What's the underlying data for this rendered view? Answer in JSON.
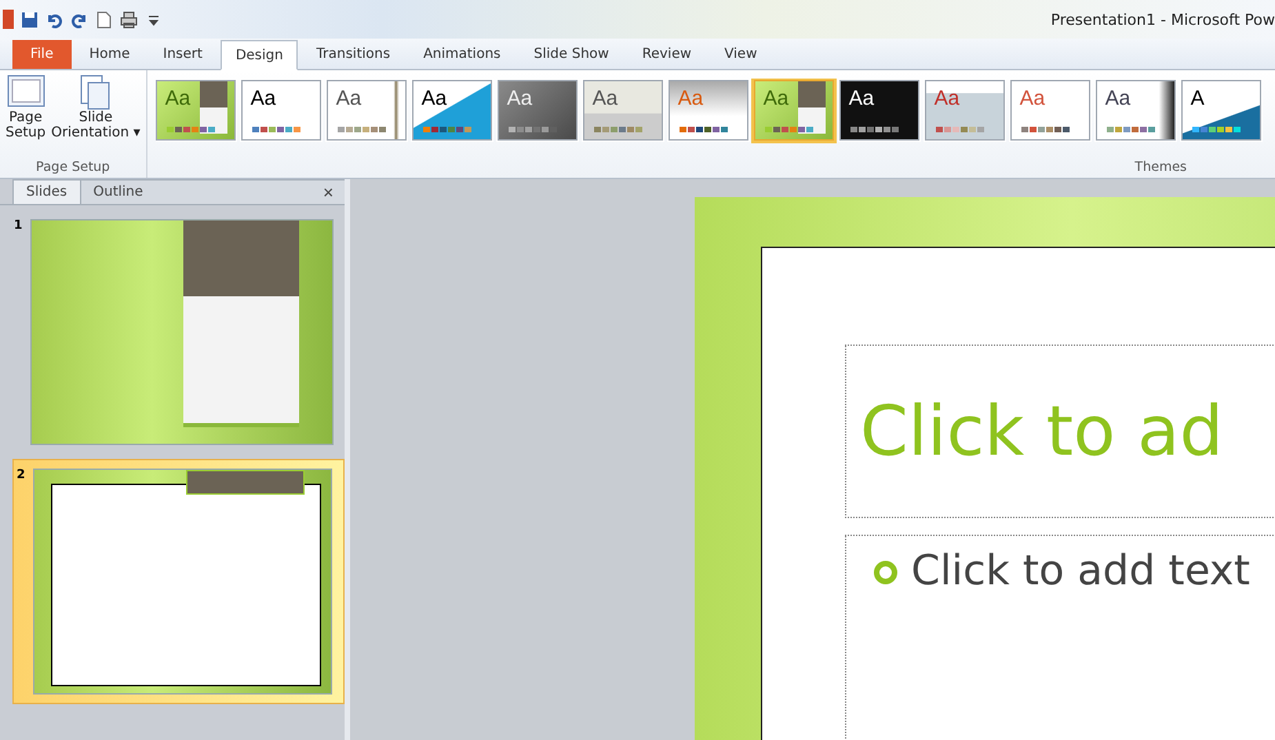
{
  "window": {
    "title": "Presentation1  -  Microsoft Pow"
  },
  "tabs": [
    {
      "label": "File",
      "kind": "file",
      "selected": false
    },
    {
      "label": "Home",
      "kind": "tab",
      "selected": false
    },
    {
      "label": "Insert",
      "kind": "tab",
      "selected": false
    },
    {
      "label": "Design",
      "kind": "tab",
      "selected": true
    },
    {
      "label": "Transitions",
      "kind": "tab",
      "selected": false
    },
    {
      "label": "Animations",
      "kind": "tab",
      "selected": false
    },
    {
      "label": "Slide Show",
      "kind": "tab",
      "selected": false
    },
    {
      "label": "Review",
      "kind": "tab",
      "selected": false
    },
    {
      "label": "View",
      "kind": "tab",
      "selected": false
    }
  ],
  "page_setup_group": {
    "label": "Page Setup",
    "buttons": [
      {
        "label": "Page\nSetup",
        "kind": "page"
      },
      {
        "label": "Slide\nOrientation ▾",
        "kind": "orient"
      }
    ]
  },
  "themes_group": {
    "label": "Themes",
    "themes": [
      {
        "sample": "Aa",
        "selected": false
      },
      {
        "sample": "Aa",
        "selected": false
      },
      {
        "sample": "Aa",
        "selected": false
      },
      {
        "sample": "Aa",
        "selected": false
      },
      {
        "sample": "Aa",
        "selected": false
      },
      {
        "sample": "Aa",
        "selected": false
      },
      {
        "sample": "Aa",
        "selected": false
      },
      {
        "sample": "Aa",
        "selected": true
      },
      {
        "sample": "Aa",
        "selected": false
      },
      {
        "sample": "Aa",
        "selected": false
      },
      {
        "sample": "Aa",
        "selected": false
      },
      {
        "sample": "Aa",
        "selected": false
      },
      {
        "sample": "A",
        "selected": false
      }
    ]
  },
  "panel": {
    "tabs": [
      {
        "label": "Slides",
        "selected": true
      },
      {
        "label": "Outline",
        "selected": false
      }
    ],
    "close": "×",
    "slides": [
      {
        "number": "1",
        "kind": "title",
        "selected": false
      },
      {
        "number": "2",
        "kind": "content",
        "selected": true
      }
    ]
  },
  "slide": {
    "title": "Click to ad",
    "bullet": "Click to add text"
  }
}
